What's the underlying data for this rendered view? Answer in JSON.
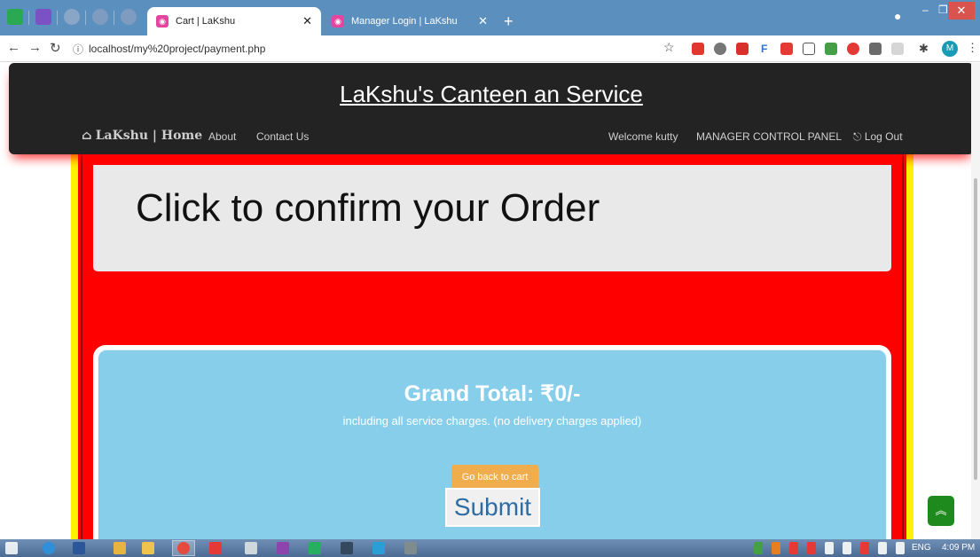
{
  "browser": {
    "tabs": [
      {
        "title": "Cart | LaKshu",
        "active": true
      },
      {
        "title": "Manager Login | LaKshu",
        "active": false
      }
    ],
    "url": "localhost/my%20project/payment.php"
  },
  "navbar": {
    "site_title": "LaKshu's Canteen an Service",
    "brand": "LaKshu | Home",
    "links_left": [
      "About",
      "Contact Us"
    ],
    "welcome": "Welcome kutty",
    "manager_panel": "MANAGER CONTROL PANEL",
    "logout": "Log Out"
  },
  "confirm": {
    "heading": "Click to confirm your Order"
  },
  "total": {
    "grand_total": "Grand Total: ₹0/-",
    "note": "including all service charges. (no delivery charges applied)",
    "back_button": "Go back to cart",
    "submit_button": "Submit"
  },
  "taskbar": {
    "lang": "ENG",
    "time": "4:09 PM"
  },
  "colors": {
    "navbar_bg": "#232323",
    "frame_red": "#ff0000",
    "frame_yellow": "#fff200",
    "panel_blue": "#87ceeb",
    "button_orange": "#f0ad4e",
    "scroll_top_green": "#1e8a1e"
  }
}
